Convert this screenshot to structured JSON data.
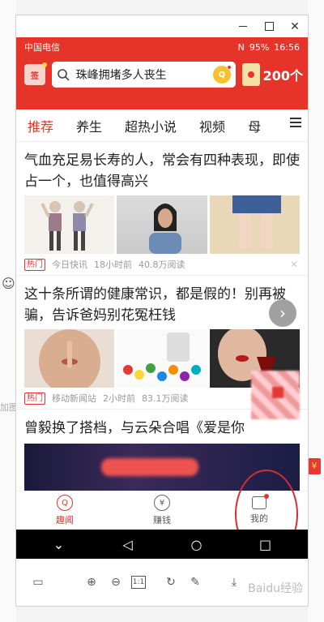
{
  "status_bar": {
    "carrier": "中国电信",
    "battery": "95%",
    "time": "16:56"
  },
  "header": {
    "checkin_label": "签",
    "search_text": "珠峰拥堵多人丧生",
    "coin_label": "Q",
    "redpacket_count": "200个"
  },
  "tabs": [
    "推荐",
    "养生",
    "超热小说",
    "视频",
    "母"
  ],
  "articles": [
    {
      "title": "气血充足易长寿的人，常会有四种表现，即使占一个，也值得高兴",
      "tag": "热门",
      "source": "今日快讯",
      "time": "18小时前",
      "reads": "40.8万阅读"
    },
    {
      "title": "这十条所谓的健康常识，都是假的！别再被骗，告诉爸妈别花冤枉钱",
      "tag": "热门",
      "source": "移动新闻站",
      "time": "2小时前",
      "reads": "83.1万阅读"
    },
    {
      "title": "曾毅换了搭档，与云朵合唱《爱是你"
    }
  ],
  "bottom_nav": [
    {
      "label": "趣闻",
      "icon": "fun-news-icon"
    },
    {
      "label": "赚钱",
      "icon": "yuan-coin-icon"
    },
    {
      "label": "我的",
      "icon": "wallet-icon"
    }
  ],
  "background": {
    "left_text": "加图。"
  },
  "watermark": "Baidu经验",
  "colors": {
    "brand_red": "#e6342a",
    "annotation_red": "#d32f2f"
  }
}
